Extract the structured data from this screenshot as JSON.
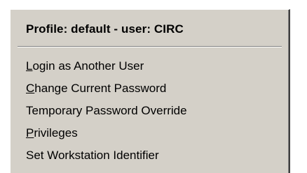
{
  "menu": {
    "header": "Profile: default - user:  CIRC",
    "items": [
      {
        "mnemonic": "L",
        "rest": "ogin as Another User"
      },
      {
        "mnemonic": "C",
        "rest": "hange Current Password"
      },
      {
        "mnemonic": "",
        "rest": "Temporary Password Override"
      },
      {
        "mnemonic": "P",
        "rest": "rivileges"
      },
      {
        "mnemonic": "",
        "rest": "Set Workstation Identifier"
      }
    ]
  }
}
